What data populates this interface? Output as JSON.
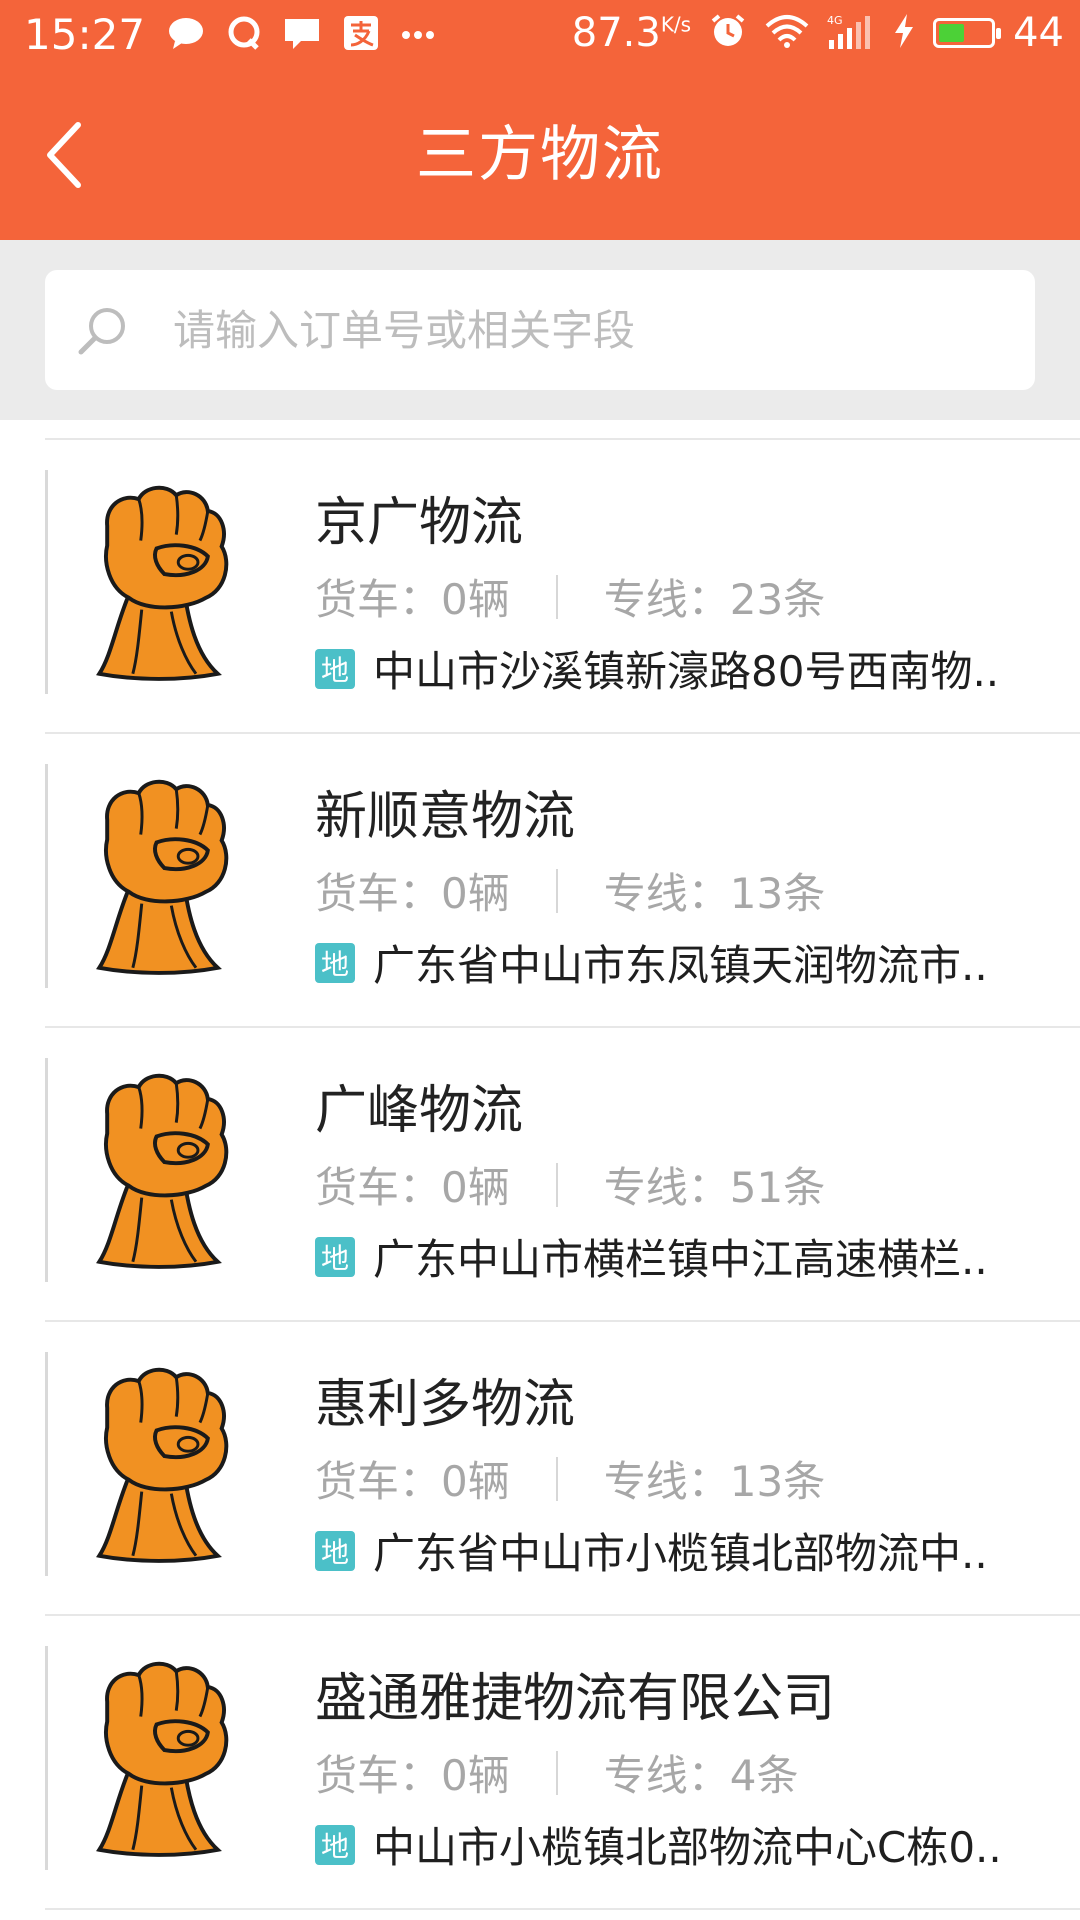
{
  "status_bar": {
    "time": "15:27",
    "speed_value": "87.3",
    "speed_unit": "K/s",
    "battery_level": "44",
    "icons": [
      "chat-icon",
      "qq-icon",
      "message-icon",
      "alipay-icon",
      "more-dots-icon",
      "alarm-icon",
      "wifi-icon",
      "4g-signal-icon",
      "charging-icon",
      "battery-icon"
    ]
  },
  "header": {
    "title": "三方物流",
    "back_icon": "chevron-left-icon"
  },
  "search": {
    "placeholder": "请输入订单号或相关字段",
    "value": ""
  },
  "list": [
    {
      "name": "京广物流",
      "trucks_label": "货车：",
      "trucks_value": "0辆",
      "lines_label": "专线：",
      "lines_value": "23条",
      "badge": "地",
      "address": "中山市沙溪镇新濠路80号西南物.."
    },
    {
      "name": "新顺意物流",
      "trucks_label": "货车：",
      "trucks_value": "0辆",
      "lines_label": "专线：",
      "lines_value": "13条",
      "badge": "地",
      "address": "广东省中山市东凤镇天润物流市.."
    },
    {
      "name": "广峰物流",
      "trucks_label": "货车：",
      "trucks_value": "0辆",
      "lines_label": "专线：",
      "lines_value": "51条",
      "badge": "地",
      "address": "广东中山市横栏镇中江高速横栏.."
    },
    {
      "name": "惠利多物流",
      "trucks_label": "货车：",
      "trucks_value": "0辆",
      "lines_label": "专线：",
      "lines_value": "13条",
      "badge": "地",
      "address": "广东省中山市小榄镇北部物流中.."
    },
    {
      "name": "盛通雅捷物流有限公司",
      "trucks_label": "货车：",
      "trucks_value": "0辆",
      "lines_label": "专线：",
      "lines_value": "4条",
      "badge": "地",
      "address": "中山市小榄镇北部物流中心C栋0.."
    }
  ],
  "colors": {
    "brand": "#f4643a",
    "badge": "#4bc0c8",
    "muted_text": "#a7a7a7",
    "fist_orange": "#f19122"
  }
}
